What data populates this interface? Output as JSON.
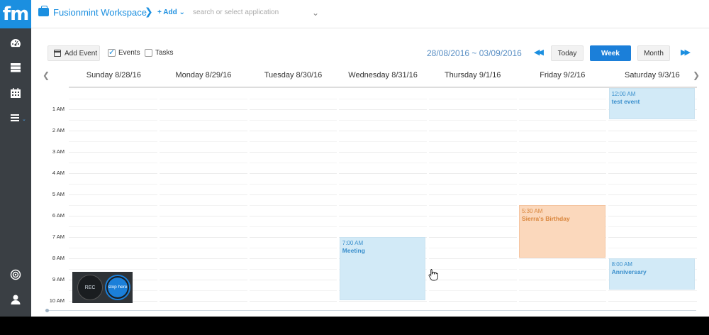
{
  "brand": {
    "logo": "fm",
    "color": "#1b8fe0"
  },
  "topbar": {
    "workspace_title": "Fusionmint Workspace",
    "chevron": "❯",
    "add_label": "+ Add ⌄",
    "search_placeholder": "search or select application",
    "search_caret": "⌄"
  },
  "sidebar": {
    "items": [
      {
        "icon": "dashboard-icon"
      },
      {
        "icon": "server-icon"
      },
      {
        "icon": "calendar-icon"
      },
      {
        "icon": "menu-icon",
        "caret": "⌄"
      },
      {
        "icon": "target-icon"
      },
      {
        "icon": "user-icon"
      }
    ]
  },
  "toolbar": {
    "add_event_label": "Add Event",
    "events_label": "Events",
    "events_checked": true,
    "tasks_label": "Tasks",
    "tasks_checked": false,
    "date_range": "28/08/2016 ~ 03/09/2016",
    "prev_glyph": "◀◀",
    "next_glyph": "▶▶",
    "today_label": "Today",
    "week_label": "Week",
    "month_label": "Month",
    "active_view": "Week"
  },
  "calendar": {
    "scroll_left": "❮",
    "scroll_right": "❯",
    "days": [
      "Sunday 8/28/16",
      "Monday 8/29/16",
      "Tuesday 8/30/16",
      "Wednesday 8/31/16",
      "Thursday 9/1/16",
      "Friday 9/2/16",
      "Saturday 9/3/16"
    ],
    "hours": [
      "1 AM",
      "2 AM",
      "3 AM",
      "4 AM",
      "5 AM",
      "6 AM",
      "7 AM",
      "8 AM",
      "9 AM",
      "10 AM"
    ],
    "events": [
      {
        "day": 6,
        "start": 0,
        "end": 1.5,
        "time": "12:00 AM",
        "title": "test event",
        "color": "blue"
      },
      {
        "day": 5,
        "start": 5.5,
        "end": 8,
        "time": "5:30 AM",
        "title": "Sierra's Birthday",
        "color": "orange"
      },
      {
        "day": 3,
        "start": 7,
        "end": 10,
        "time": "7:00 AM",
        "title": "Meeting",
        "color": "blue"
      },
      {
        "day": 6,
        "start": 8,
        "end": 9.5,
        "time": "8:00 AM",
        "title": "Anniversary",
        "color": "blue"
      }
    ]
  },
  "recorder": {
    "rec_label": "REC",
    "stop_label": "stop here"
  },
  "colors": {
    "accent": "#1b7fd9",
    "event_blue": "#d2eaf7",
    "event_orange": "#fbd8bc",
    "sidebar": "#3a3f44"
  }
}
